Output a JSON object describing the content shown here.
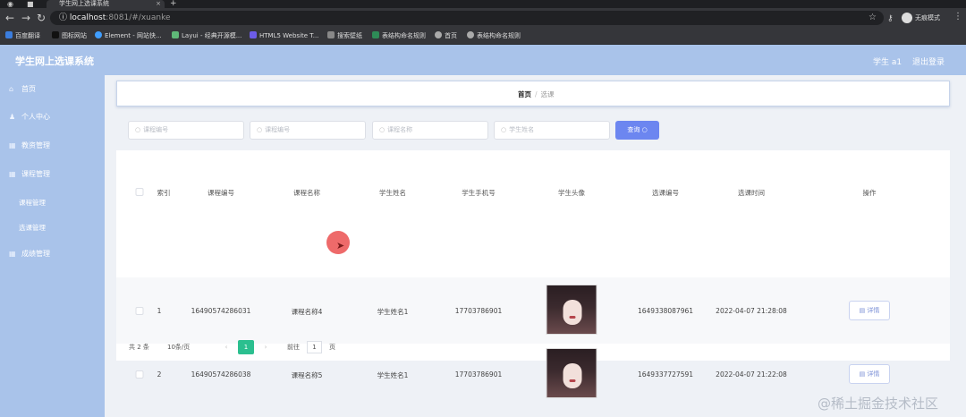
{
  "browser": {
    "tab_title": "学生网上选课系统",
    "url_host": "localhost",
    "url_rest": ":8081/#/xuanke",
    "incognito_label": "无痕模式",
    "bookmarks": [
      {
        "label": "百度翻译",
        "color": "#3b7ddd"
      },
      {
        "label": "图标网站",
        "color": "#333333"
      },
      {
        "label": "Element - 网站快...",
        "color": "#409eff"
      },
      {
        "label": "Layui - 经典开源模...",
        "color": "#5fb878"
      },
      {
        "label": "HTML5 Website T...",
        "color": "#6c5ce7"
      },
      {
        "label": "搜索壁纸",
        "color": "#444444"
      },
      {
        "label": "表结构命名规则",
        "color": "#2e8b57"
      },
      {
        "label": "首页",
        "color": "#666666"
      },
      {
        "label": "表结构命名规则",
        "color": "#666666"
      }
    ]
  },
  "header": {
    "title": "学生网上选课系统",
    "user": "学生 a1",
    "logout": "退出登录"
  },
  "sidebar": {
    "items": [
      {
        "label": "首页",
        "icon": "home-icon"
      },
      {
        "label": "个人中心",
        "icon": "user-icon"
      },
      {
        "label": "教资管理",
        "icon": "grid-icon"
      },
      {
        "label": "课程管理",
        "icon": "grid-icon"
      },
      {
        "label": "成绩管理",
        "icon": "grid-icon"
      }
    ],
    "subitems": [
      "课程管理",
      "选课管理"
    ]
  },
  "breadcrumb": {
    "home": "首页",
    "separator": "/",
    "current": "选课"
  },
  "search": {
    "fields": [
      "课程编号",
      "课程编号",
      "课程名称",
      "学生姓名"
    ],
    "button": "查询"
  },
  "table": {
    "columns": [
      "索引",
      "课程编号",
      "课程名称",
      "学生姓名",
      "学生手机号",
      "学生头像",
      "选课编号",
      "选课时间",
      "操作"
    ],
    "rows": [
      {
        "index": "1",
        "course_no": "16490574286031",
        "course_name": "课程名称4",
        "student": "学生姓名1",
        "phone": "17703786901",
        "select_no": "1649338087961",
        "time": "2022-04-07 21:28:08",
        "action": "详情"
      },
      {
        "index": "2",
        "course_no": "16490574286038",
        "course_name": "课程名称5",
        "student": "学生姓名1",
        "phone": "17703786901",
        "select_no": "1649337727591",
        "time": "2022-04-07 21:22:08",
        "action": "详情"
      }
    ]
  },
  "pagination": {
    "total": "共 2 条",
    "page_size": "10条/页",
    "prev": "‹",
    "current": "1",
    "next": "›",
    "goto": "前往",
    "goto_value": "1",
    "page_unit": "页"
  },
  "watermark": "@稀土掘金技术社区",
  "colors": {
    "header": "#a9c3ea",
    "search_button": "#6c86f0",
    "current_page": "#2bbf8f"
  }
}
